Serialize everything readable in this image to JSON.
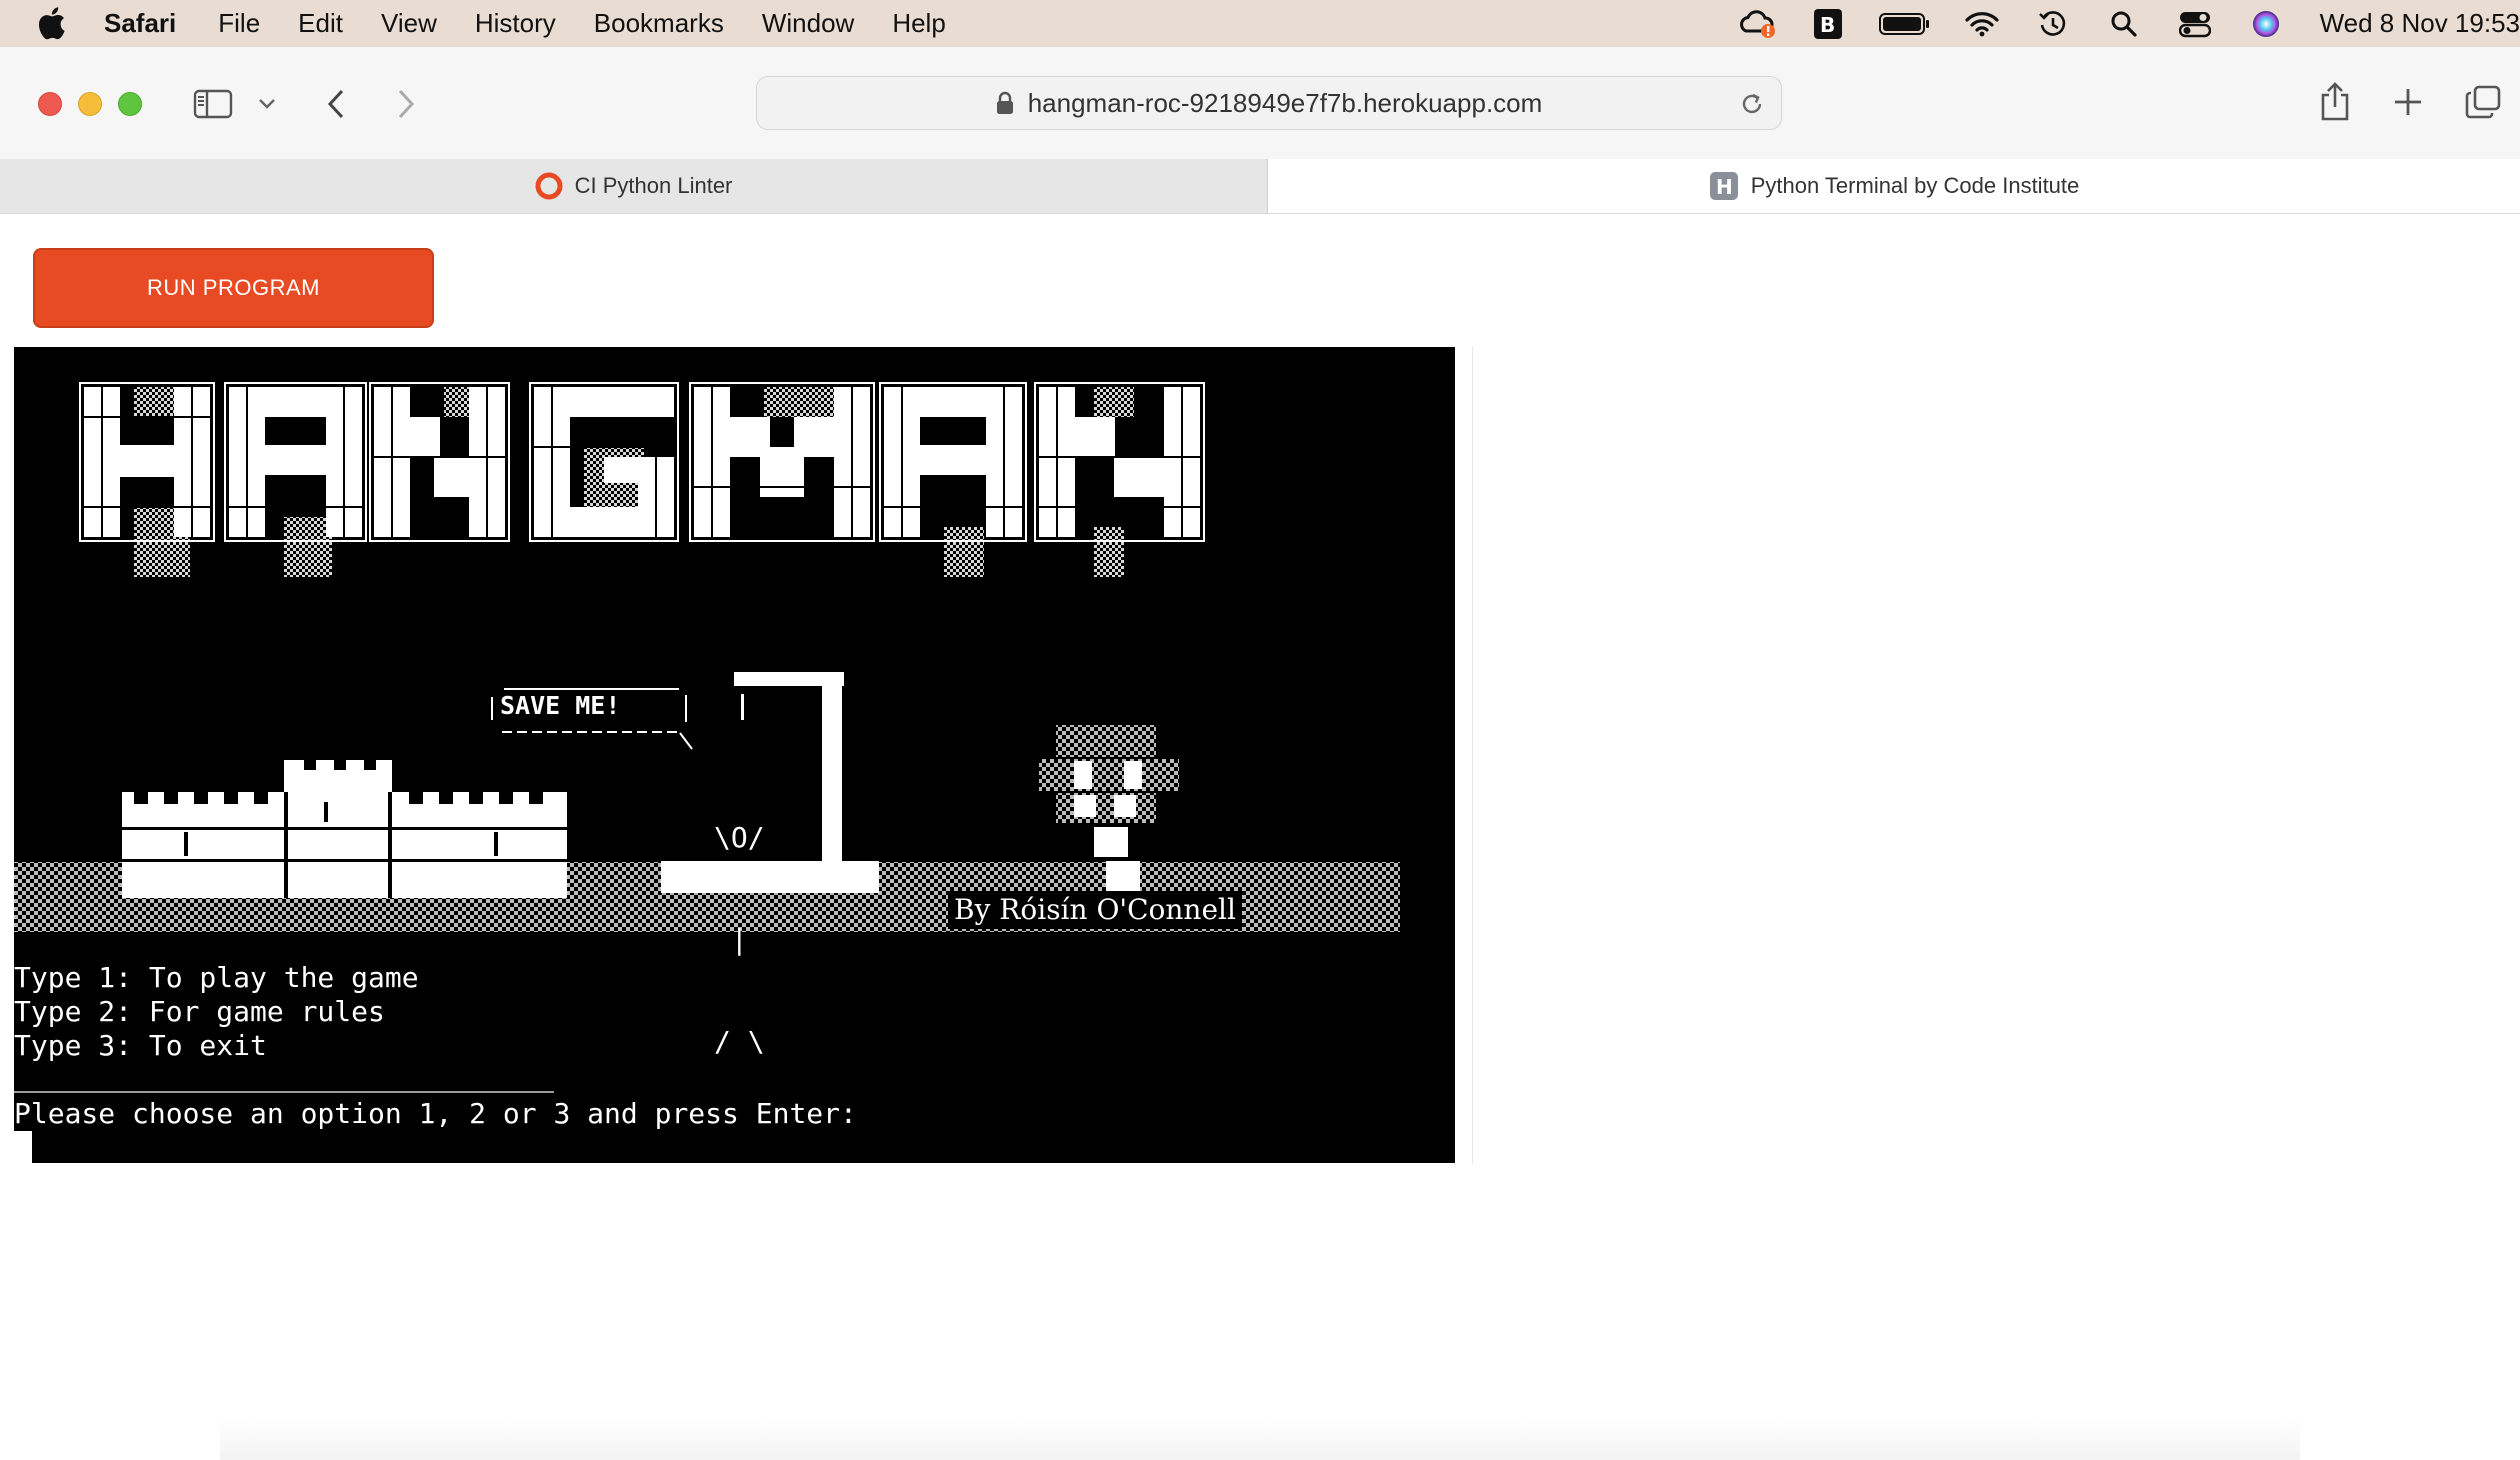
{
  "menubar": {
    "app_name": "Safari",
    "menus": [
      "File",
      "Edit",
      "View",
      "History",
      "Bookmarks",
      "Window",
      "Help"
    ],
    "clock": "Wed 8 Nov  19:53",
    "status_icons": [
      "creative-cloud-icon",
      "bbedit-icon",
      "battery-icon",
      "wifi-icon",
      "time-machine-icon",
      "spotlight-search-icon",
      "control-center-icon",
      "siri-icon"
    ]
  },
  "toolbar": {
    "url": "hangman-roc-9218949e7f7b.herokuapp.com"
  },
  "tabs": [
    {
      "label": "CI Python Linter",
      "icon": "ci-linter-favicon",
      "active": false
    },
    {
      "label": "Python Terminal by Code Institute",
      "icon": "h-favicon",
      "active": true
    }
  ],
  "page": {
    "run_button": "RUN PROGRAM"
  },
  "terminal": {
    "logo_text": "HANGMAN",
    "speech_bubble": "SAVE ME!",
    "stickman_lines": [
      "\\O/",
      " | ",
      "/ \\"
    ],
    "credit": "By Róisín O'Connell",
    "menu_lines": [
      "Type 1: To play the game",
      "Type 2: For game rules",
      "Type 3: To exit"
    ],
    "prompt": "Please choose an option 1, 2 or 3 and press Enter:"
  },
  "colors": {
    "menubar_bg": "#e9ddd3",
    "run_button": "#e84b24",
    "terminal_bg": "#000000",
    "terminal_fg": "#ffffff"
  }
}
